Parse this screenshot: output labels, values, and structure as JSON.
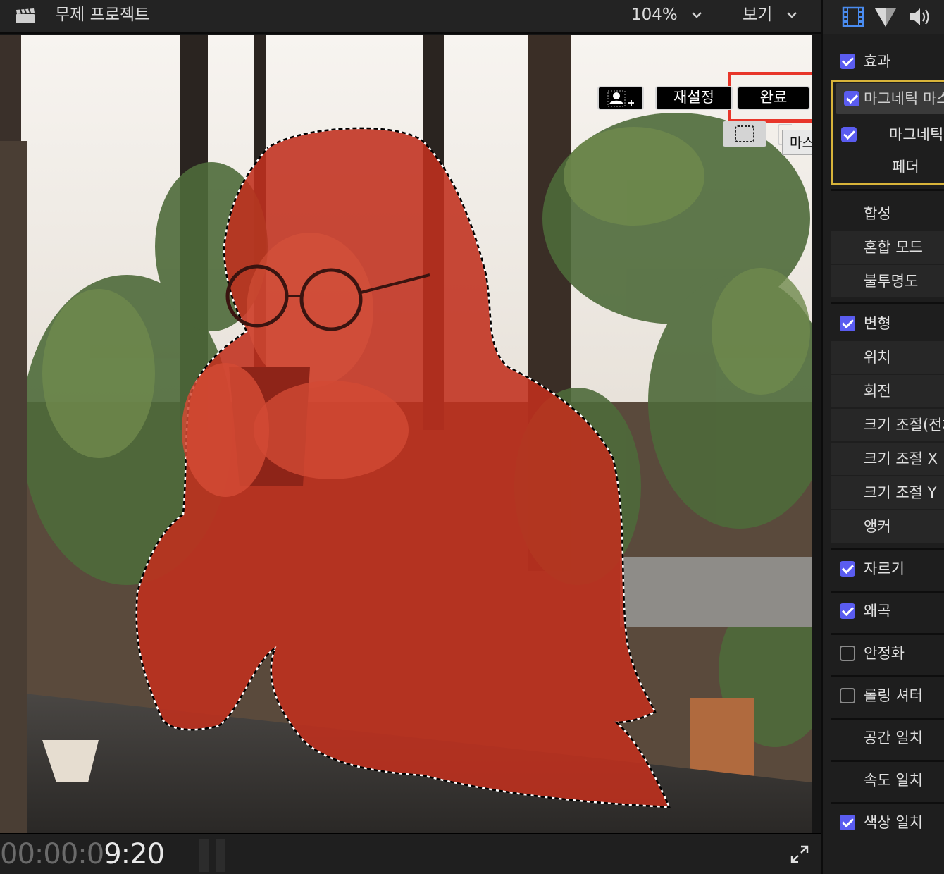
{
  "topbar": {
    "project_title": "무제 프로젝트",
    "zoom": "104%",
    "view_label": "보기"
  },
  "viewer": {
    "reset_label": "재설정",
    "done_label": "완료",
    "tooltip": "마스크 결과 보기",
    "timecode_dim": "00:00:0",
    "timecode_bright": "9:20"
  },
  "inspector": {
    "effects": {
      "label": "효과",
      "checked": true
    },
    "magnetic_mask_header": "마그네틱 마스크",
    "magnetic_row": {
      "label": "마그네틱 마스크",
      "checked": true
    },
    "feather": "페더",
    "compositing": "합성",
    "blend_mode": "혼합 모드",
    "opacity": "불투명도",
    "transform": {
      "label": "변형",
      "checked": true
    },
    "position": "위치",
    "rotation": "회전",
    "scale_all": "크기 조절(전체)",
    "scale_x": "크기 조절 X",
    "scale_y": "크기 조절 Y",
    "anchor": "앵커",
    "crop": {
      "label": "자르기",
      "checked": true
    },
    "distort": {
      "label": "왜곡",
      "checked": true
    },
    "stabilization": {
      "label": "안정화",
      "checked": false
    },
    "rolling_shutter": {
      "label": "롤링 셔터",
      "checked": false
    },
    "spatial_conform": "공간 일치",
    "rate_conform": "속도 일치",
    "color_conform": {
      "label": "색상 일치",
      "checked": true
    }
  },
  "colors": {
    "accent_checkbox": "#5a5cf0",
    "highlight_box": "#e8362a",
    "mask_overlay": "#c0301e",
    "magnetic_outline": "#d8b43a"
  },
  "icons": {
    "clapper": "clapperboard-icon",
    "add_person": "person-add-icon",
    "mask_rect": "dashed-rectangle-icon",
    "fullscreen": "expand-icon",
    "tab_video": "film-strip-icon",
    "tab_color": "color-triangle-icon",
    "tab_audio": "speaker-icon"
  }
}
